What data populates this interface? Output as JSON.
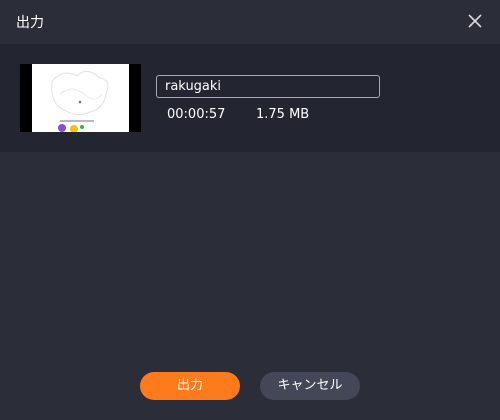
{
  "window": {
    "title": "出力",
    "close_icon": "close-icon"
  },
  "video": {
    "thumbnail_icon": "video-thumbnail",
    "name_value": "rakugaki",
    "duration": "00:00:57",
    "size": "1.75 MB"
  },
  "footer": {
    "export_label": "出力",
    "cancel_label": "キャンセル"
  },
  "colors": {
    "accent": "#ff7a1a",
    "background": "#2b2d38",
    "panel": "#232530"
  }
}
